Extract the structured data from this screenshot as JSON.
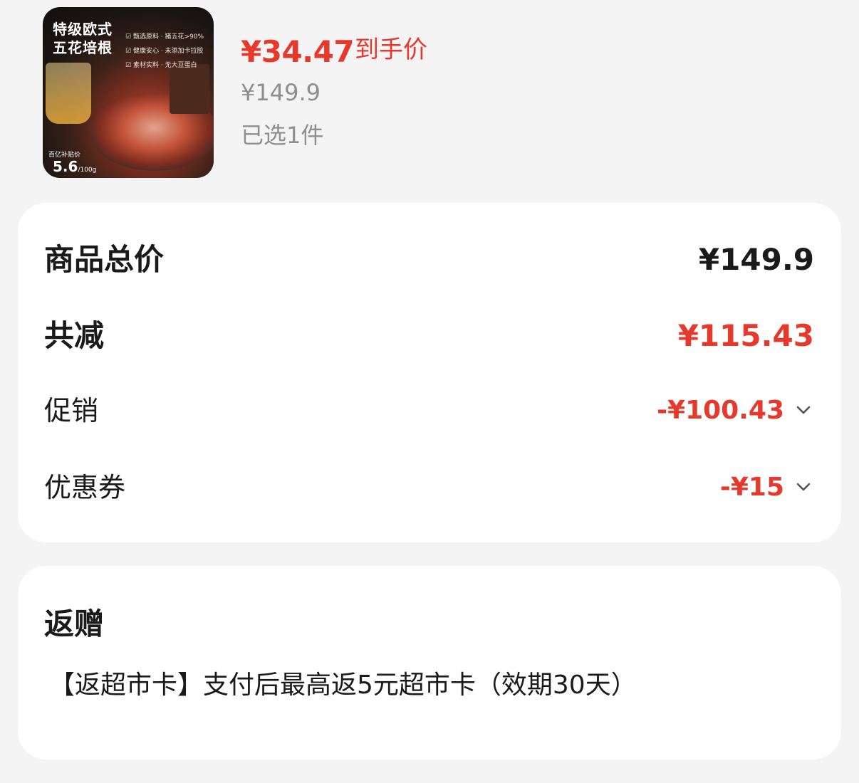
{
  "product": {
    "image": {
      "title_line1": "特级欧式",
      "title_line2": "五花培根",
      "features": [
        "甄选原料 · 猪五花>90%",
        "健康安心 · 未添加卡拉胶",
        "素材实料 · 无大豆蛋白"
      ],
      "subsidy_label": "百亿补贴价",
      "subsidy_price": "5.6",
      "subsidy_unit": "/100g"
    },
    "deal_price": "¥34.47",
    "deal_label": "到手价",
    "original_price": "¥149.9",
    "selected_count": "已选1件"
  },
  "summary": {
    "total_label": "商品总价",
    "total_value": "¥149.9",
    "discount_label": "共减",
    "discount_value": "¥115.43",
    "promo_label": "促销",
    "promo_value": "-¥100.43",
    "coupon_label": "优惠券",
    "coupon_value": "-¥15"
  },
  "gift": {
    "title": "返赠",
    "description": "【返超市卡】支付后最高返5元超市卡（效期30天）"
  },
  "colors": {
    "accent_red": "#e4392c",
    "muted_gray": "#8e8e8e",
    "background": "#f4f4f4"
  }
}
